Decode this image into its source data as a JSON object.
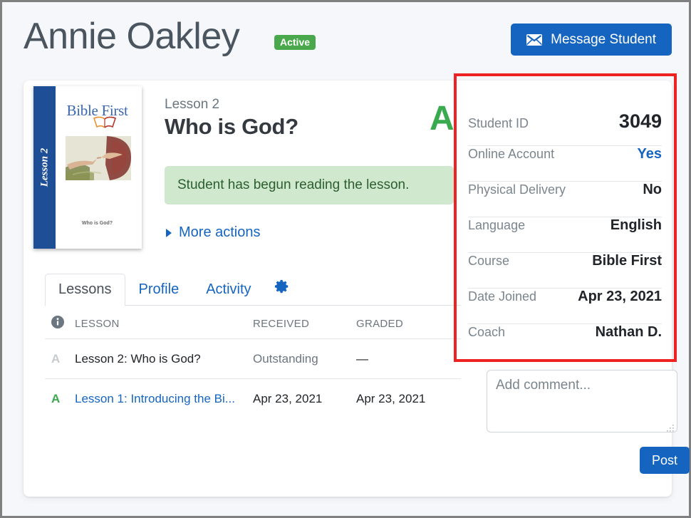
{
  "header": {
    "student_name": "Annie Oakley",
    "status_badge": "Active",
    "message_button": "Message Student"
  },
  "lesson": {
    "number_label": "Lesson 2",
    "title": "Who is God?",
    "grade": "A",
    "status_banner": "Student has begun reading the lesson.",
    "more_actions": "More actions",
    "book_cover": {
      "spine_label": "Lesson 2",
      "title": "Bible First",
      "subtitle": "Who is God?"
    }
  },
  "tabs": [
    {
      "label": "Lessons",
      "active": true
    },
    {
      "label": "Profile",
      "active": false
    },
    {
      "label": "Activity",
      "active": false
    }
  ],
  "tab_settings_icon": "gear-icon",
  "lessons_table": {
    "columns": [
      "",
      "LESSON",
      "RECEIVED",
      "GRADED"
    ],
    "rows": [
      {
        "grade": "A",
        "grade_state": "faded",
        "lesson": "Lesson 2: Who is God?",
        "lesson_is_link": false,
        "received": "Outstanding",
        "received_muted": true,
        "graded": "—"
      },
      {
        "grade": "A",
        "grade_state": "green",
        "lesson": "Lesson 1: Introducing the Bi...",
        "lesson_is_link": true,
        "received": "Apr 23, 2021",
        "received_muted": false,
        "graded": "Apr 23, 2021"
      }
    ]
  },
  "details": [
    {
      "label": "Student ID",
      "value": "3049",
      "style": "big"
    },
    {
      "label": "Online Account",
      "value": "Yes",
      "style": "link"
    },
    {
      "label": "Physical Delivery",
      "value": "No",
      "style": ""
    },
    {
      "label": "Language",
      "value": "English",
      "style": ""
    },
    {
      "label": "Course",
      "value": "Bible First",
      "style": ""
    },
    {
      "label": "Date Joined",
      "value": "Apr 23, 2021",
      "style": ""
    },
    {
      "label": "Coach",
      "value": "Nathan D.",
      "style": ""
    }
  ],
  "comment": {
    "placeholder": "Add comment...",
    "value": "",
    "post_label": "Post"
  },
  "colors": {
    "primary_blue": "#1565c0",
    "active_green": "#49a84c",
    "grade_green": "#3aaa4f",
    "banner_green_bg": "#cfe8ce",
    "banner_green_text": "#2c5e2e",
    "highlight_red": "#ee2222",
    "muted_text": "#6b7680",
    "heading_gray": "#4a5560"
  }
}
